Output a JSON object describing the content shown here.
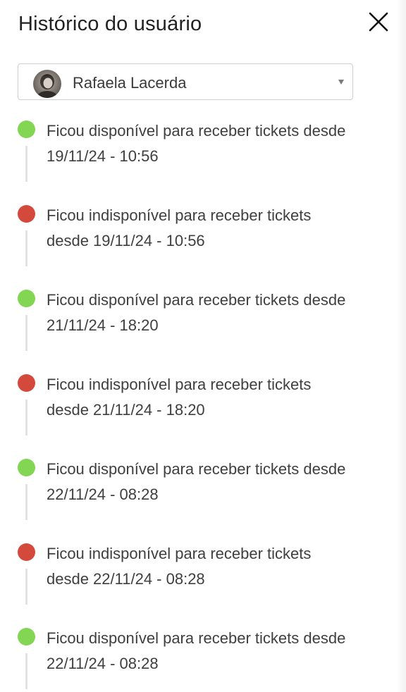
{
  "header": {
    "title": "Histórico do usuário",
    "close_icon": "close-icon"
  },
  "user_select": {
    "selected_name": "Rafaela Lacerda",
    "avatar_icon": "avatar",
    "caret_icon": "chevron-down-icon"
  },
  "colors": {
    "available": "#82d654",
    "unavailable": "#d34a3c",
    "line": "#e3e3e3"
  },
  "events": [
    {
      "status": "available",
      "line1": "Ficou disponível para receber tickets desde",
      "line2": "19/11/24 - 10:56"
    },
    {
      "status": "unavailable",
      "line1": "Ficou indisponível para receber tickets",
      "line2": "desde 19/11/24 - 10:56"
    },
    {
      "status": "available",
      "line1": "Ficou disponível para receber tickets desde",
      "line2": "21/11/24 - 18:20"
    },
    {
      "status": "unavailable",
      "line1": "Ficou indisponível para receber tickets",
      "line2": "desde 21/11/24 - 18:20"
    },
    {
      "status": "available",
      "line1": "Ficou disponível para receber tickets desde",
      "line2": "22/11/24 - 08:28"
    },
    {
      "status": "unavailable",
      "line1": "Ficou indisponível para receber tickets",
      "line2": "desde 22/11/24 - 08:28"
    },
    {
      "status": "available",
      "line1": "Ficou disponível para receber tickets desde",
      "line2": "22/11/24 - 08:28"
    }
  ]
}
